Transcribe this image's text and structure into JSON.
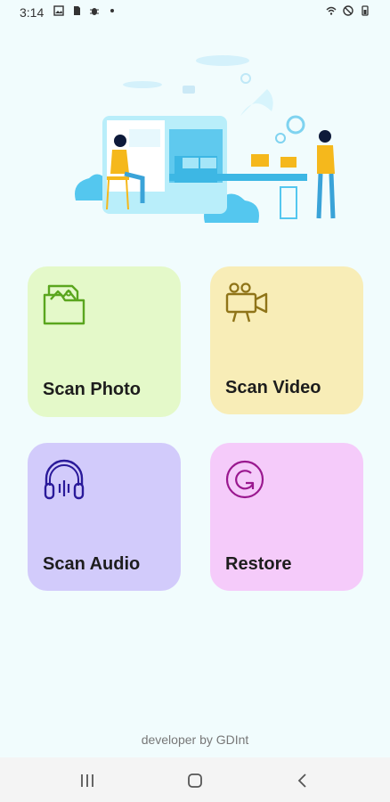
{
  "status_bar": {
    "time": "3:14",
    "left_icons": [
      "image-icon",
      "sim-icon",
      "bug-icon",
      "dot-icon"
    ],
    "right_icons": [
      "wifi-icon",
      "do-not-disturb-icon",
      "battery-icon"
    ]
  },
  "cards": [
    {
      "label": "Scan Photo",
      "icon": "photo-folder-icon",
      "bg": "#e4f9c9",
      "stroke": "#5aa61e"
    },
    {
      "label": "Scan Video",
      "icon": "video-camera-icon",
      "bg": "#f8edb7",
      "stroke": "#8f7418"
    },
    {
      "label": "Scan Audio",
      "icon": "headphones-icon",
      "bg": "#d2cbfb",
      "stroke": "#2a1a9a"
    },
    {
      "label": "Restore",
      "icon": "restore-icon",
      "bg": "#f5cbfa",
      "stroke": "#9a188f"
    }
  ],
  "footer": {
    "text": "developer by GDInt"
  },
  "navbar": {
    "items": [
      "recents-icon",
      "home-icon",
      "back-icon"
    ]
  }
}
